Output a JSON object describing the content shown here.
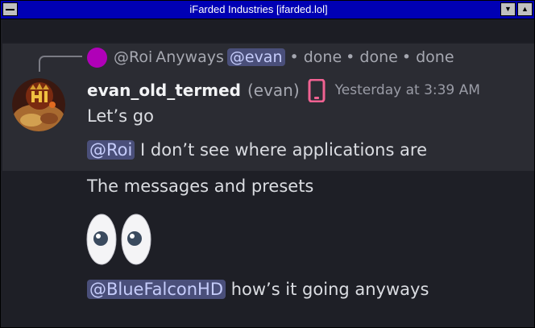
{
  "window": {
    "title": "iFarded Industries [ifarded.lol]",
    "minimize_glyph": "▼",
    "maximize_glyph": "▲"
  },
  "reply": {
    "author": "@Roi",
    "text": "Anyways",
    "mention": "@evan",
    "extras": [
      "• done",
      "• done",
      "• done"
    ],
    "avatar_color": "#b000b8"
  },
  "message": {
    "username": "evan_old_termed",
    "nickname": "(evan)",
    "device_icon": "phone-icon",
    "timestamp": "Yesterday at 3:39 AM",
    "lines": [
      {
        "text": "Let’s go"
      },
      {
        "mention": "@Roi",
        "text": "I don’t see where applications are"
      },
      {
        "text": "The messages and presets"
      },
      {
        "emoji": "eyes-emoji"
      },
      {
        "mention": "@BlueFalconHD",
        "text": "how’s it going anyways"
      }
    ]
  },
  "colors": {
    "titlebar": "#0000b4",
    "background": "#1e1f26",
    "highlight": "#2b2c33",
    "mention_bg": "#4a4f7a",
    "mention_text": "#c6cdfb",
    "phone_icon": "#f06292"
  }
}
